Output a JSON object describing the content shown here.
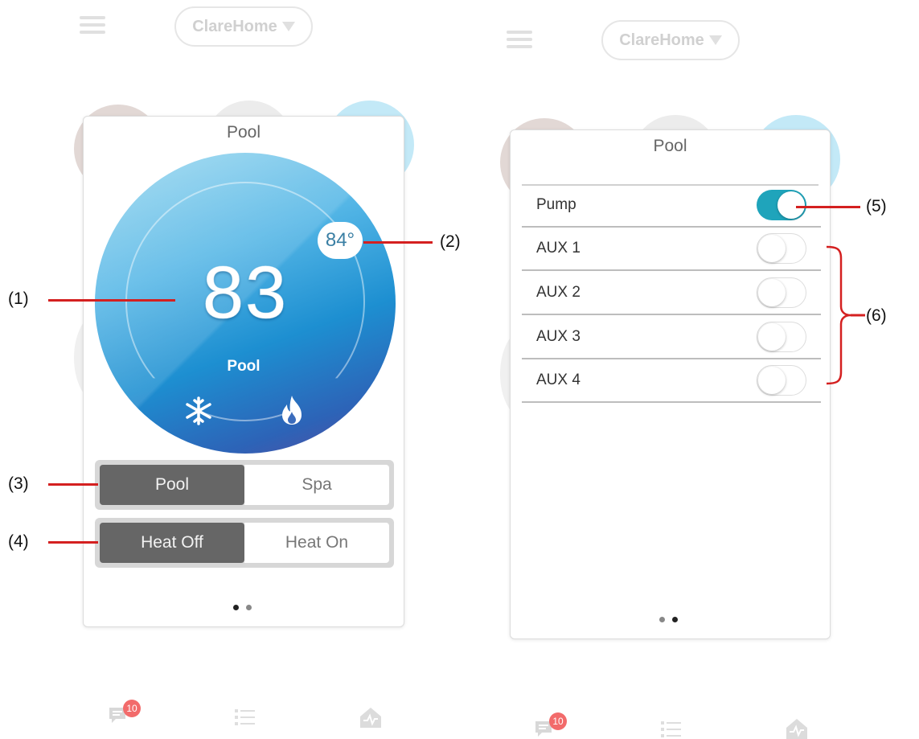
{
  "left_screen": {
    "home_selector": "ClareHome",
    "card_title": "Pool",
    "current_temp": "83",
    "setpoint": "84°",
    "dial_label": "Pool",
    "mode_options": [
      "Pool",
      "Spa"
    ],
    "mode_selected": "Pool",
    "heat_options": [
      "Heat Off",
      "Heat On"
    ],
    "heat_selected": "Heat Off",
    "page_indicator": {
      "pages": 2,
      "current": 1
    },
    "notification_badge": "10"
  },
  "right_screen": {
    "home_selector": "ClareHome",
    "card_title": "Pool",
    "toggles": [
      {
        "label": "Pump",
        "on": true
      },
      {
        "label": "AUX 1",
        "on": false
      },
      {
        "label": "AUX 2",
        "on": false
      },
      {
        "label": "AUX 3",
        "on": false
      },
      {
        "label": "AUX 4",
        "on": false
      }
    ],
    "page_indicator": {
      "pages": 2,
      "current": 2
    },
    "notification_badge": "10"
  },
  "callouts": {
    "c1": "(1)",
    "c2": "(2)",
    "c3": "(3)",
    "c4": "(4)",
    "c5": "(5)",
    "c6": "(6)"
  },
  "colors": {
    "toggle_on": "#1fa4bb",
    "segment_active": "#666666",
    "callout_line": "#d42020"
  },
  "icons": [
    "menu-icon",
    "dropdown-triangle-icon",
    "snowflake-icon",
    "flame-icon",
    "messages-icon",
    "list-icon",
    "home-activity-icon"
  ]
}
